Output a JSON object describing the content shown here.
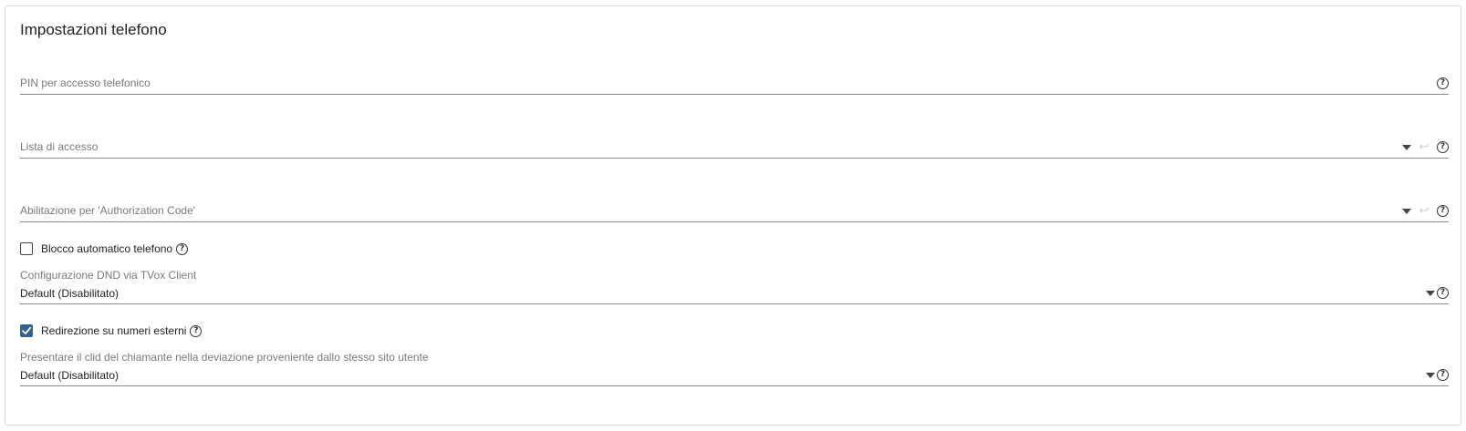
{
  "section": {
    "title": "Impostazioni telefono"
  },
  "pin_field": {
    "placeholder": "PIN per accesso telefonico"
  },
  "access_list": {
    "placeholder": "Lista di accesso"
  },
  "auth_code": {
    "placeholder": "Abilitazione per 'Authorization Code'"
  },
  "auto_lock": {
    "label": "Blocco automatico telefono",
    "checked": false
  },
  "dnd_config": {
    "label": "Configurazione DND via TVox Client",
    "value": "Default (Disabilitato)"
  },
  "external_redirect": {
    "label": "Redirezione su numeri esterni",
    "checked": true
  },
  "present_clid": {
    "label": "Presentare il clid del chiamante nella deviazione proveniente dallo stesso sito utente",
    "value": "Default (Disabilitato)"
  },
  "icons": {
    "help": "?",
    "undo": "↩",
    "check": "✓"
  },
  "colors": {
    "accent": "#35618f",
    "border": "#d9d9d9",
    "underline": "#8a8a8a",
    "placeholder": "#7a7a7a"
  }
}
